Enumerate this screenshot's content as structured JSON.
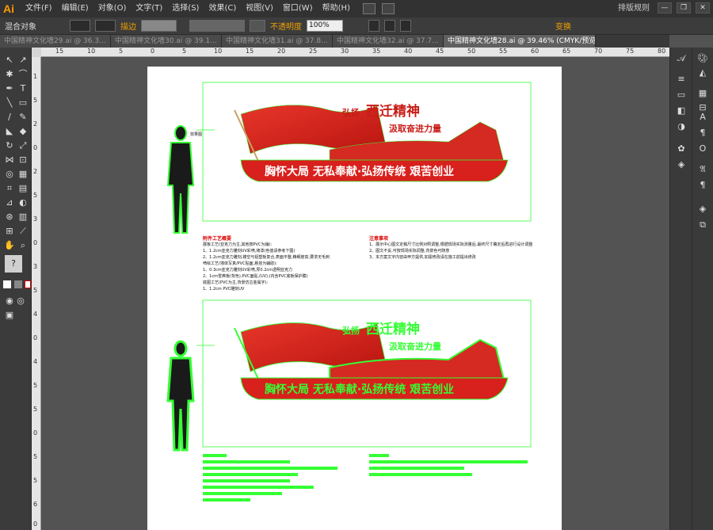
{
  "app": {
    "logo": "Ai"
  },
  "menu": [
    "文件(F)",
    "编辑(E)",
    "对象(O)",
    "文字(T)",
    "选择(S)",
    "效果(C)",
    "视图(V)",
    "窗口(W)",
    "帮助(H)"
  ],
  "menubar_right": "排版规则",
  "window_buttons": [
    "—",
    "❐",
    "✕"
  ],
  "control_bar": {
    "selection_label": "混合对象",
    "stroke_label": "描边",
    "opacity_label": "不透明度",
    "opacity_value": "100%",
    "transform_label": "变换"
  },
  "tabs": [
    {
      "label": "中国精神文化墙29.ai @ 36.3..."
    },
    {
      "label": "中国精神文化墙30.ai @ 39.1..."
    },
    {
      "label": "中国精神文化墙31.ai @ 37.8..."
    },
    {
      "label": "中国精神文化墙32.ai @ 37.7..."
    },
    {
      "label": "中国精神文化墙28.ai @ 39.46% (CMYK/预览)",
      "active": true,
      "close": "×"
    }
  ],
  "ruler_top": [
    "15",
    "10",
    "5",
    "0",
    "5",
    "10",
    "15",
    "20",
    "25",
    "30",
    "35",
    "40",
    "45",
    "50",
    "55",
    "60",
    "65",
    "70",
    "75",
    "80"
  ],
  "ruler_left": [
    "1",
    "5",
    "2",
    "0",
    "2",
    "5",
    "3",
    "0",
    "3",
    "5",
    "4",
    "0",
    "4",
    "5",
    "5",
    "0",
    "5",
    "5",
    "6",
    "0"
  ],
  "artwork": {
    "headline1": "弘扬",
    "headline2": "西迁精神",
    "headline3": "汲取奋进力量",
    "banner": "胸怀大局 无私奉献·弘扬传统 艰苦创业",
    "figure_label": "效果图",
    "notes_title_left": "附件工艺概要",
    "notes_title_right": "注意事项",
    "notes_left": [
      "展板工艺(亚克力为主,其他按PVC为辅):",
      "1、1.2cm亚克力雕刻UV彩喷,烤漆(色值请参考下图)",
      "2、1.2cm亚克力雕刻,镂空与铝塑板复合,表面平整,精细度高,要求无毛刺",
      "喷绘工艺(墙体写真/PVC贴面,悬挂为辅助):",
      "1、0.3cm亚克力雕刻UV彩喷,厚0.2cm透明亚克力",
      "2、1cm雪弗板(背色),PVC面贴,(UV),(内含PVC底板保护膜)",
      "底图工艺(PVC为主,背景仿古金属字):",
      "1、1.2cm PVC雕刻UV"
    ],
    "notes_right": [
      "1、展示中心图文定稿尺寸比例对照调整,根据现场实际测量后,最终尺寸确定后再进行设计调整",
      "2、图文不妥,可按现场实际调整,背景色可随意",
      "3、本方案文字内容由甲方提供,如需修改请在施工前提出修改"
    ]
  },
  "colors": {
    "accent": "#ff9a00",
    "selection": "#33ff33",
    "flag_red": "#d8201c",
    "ui_bg": "#535353"
  }
}
